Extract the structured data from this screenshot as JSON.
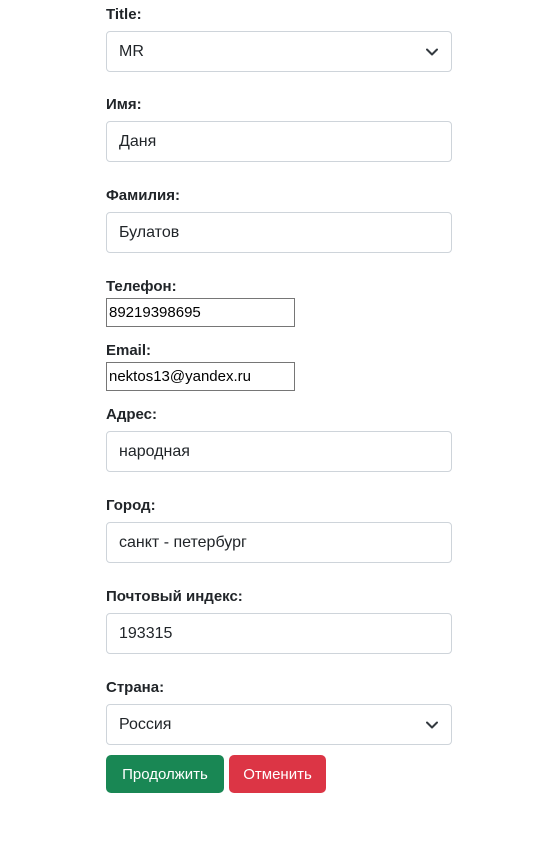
{
  "form": {
    "title_field": {
      "label": "Title:",
      "selected": "MR"
    },
    "first_name": {
      "label": "Имя:",
      "value": "Даня"
    },
    "last_name": {
      "label": "Фамилия:",
      "value": "Булатов"
    },
    "phone": {
      "label": "Телефон:",
      "value": "89219398695"
    },
    "email": {
      "label": "Email:",
      "value": "nektos13@yandex.ru"
    },
    "address": {
      "label": "Адрес:",
      "value": "народная"
    },
    "city": {
      "label": "Город:",
      "value": "санкт - петербург"
    },
    "postal_code": {
      "label": "Почтовый индекс:",
      "value": "193315"
    },
    "country": {
      "label": "Страна:",
      "selected": "Россия"
    },
    "buttons": {
      "continue_label": "Продолжить",
      "cancel_label": "Отменить"
    }
  },
  "icons": {
    "select_arrow": "chevron-down-icon"
  },
  "colors": {
    "continue_button": "#198754",
    "cancel_button": "#dc3545",
    "input_border": "#ced4da",
    "text": "#212529"
  }
}
